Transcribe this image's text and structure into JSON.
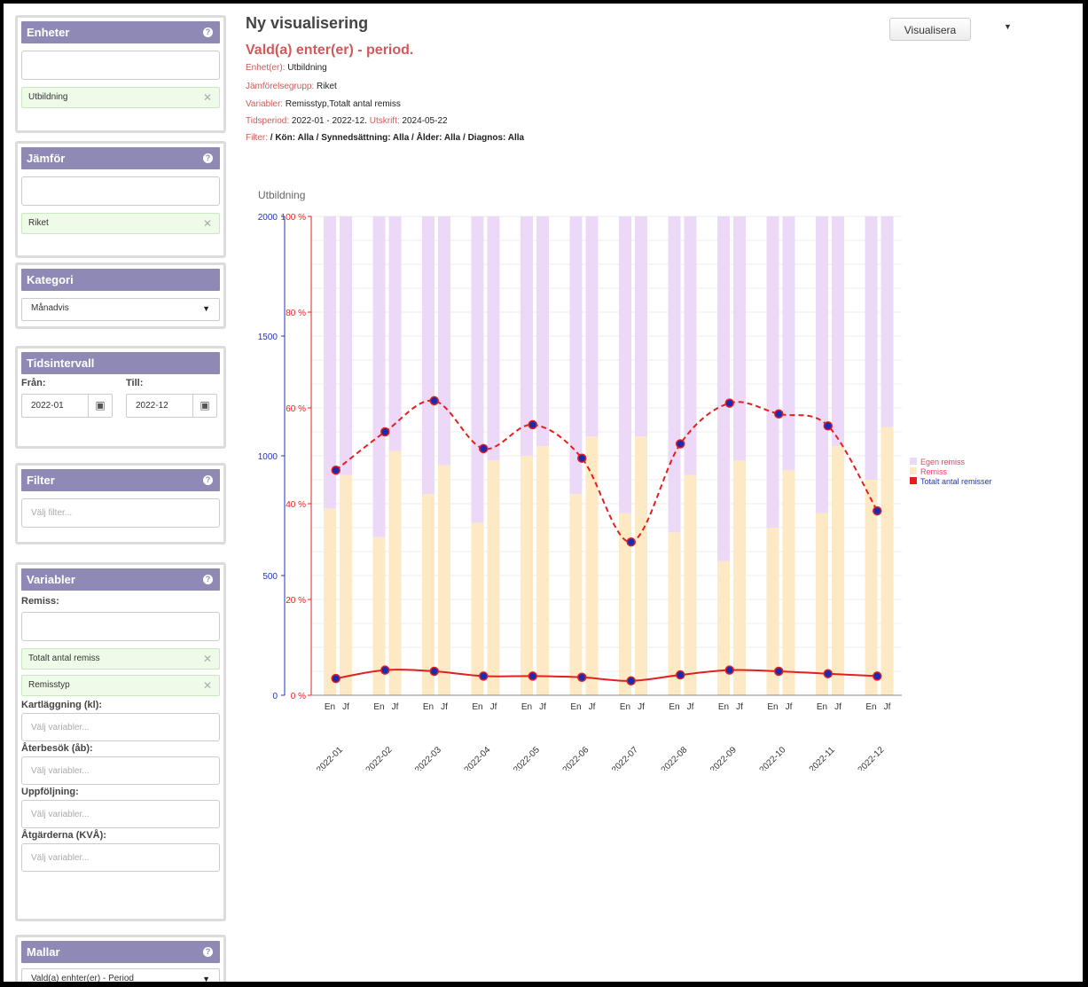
{
  "sidebar": {
    "enheter": {
      "title": "Enheter",
      "search_value": "",
      "tags": [
        "Utbildning"
      ]
    },
    "jamfor": {
      "title": "Jämför",
      "search_value": "",
      "tags": [
        "Riket"
      ]
    },
    "kategori": {
      "title": "Kategori",
      "selected": "Månadvis"
    },
    "tidsintervall": {
      "title": "Tidsintervall",
      "from_label": "Från:",
      "to_label": "Till:",
      "from_value": "2022-01",
      "to_value": "2022-12"
    },
    "filter": {
      "title": "Filter",
      "placeholder": "Välj filter..."
    },
    "variabler": {
      "title": "Variabler",
      "remiss_label": "Remiss:",
      "remiss_tags": [
        "Totalt antal remiss",
        "Remisstyp"
      ],
      "groups": [
        {
          "label": "Kartläggning (kl):",
          "placeholder": "Välj variabler..."
        },
        {
          "label": "Återbesök (åb):",
          "placeholder": "Välj variabler..."
        },
        {
          "label": "Uppföljning:",
          "placeholder": "Välj variabler..."
        },
        {
          "label": "Åtgärderna (KVÅ):",
          "placeholder": "Välj variabler..."
        }
      ]
    },
    "mallar": {
      "title": "Mallar",
      "selected": "Vald(a) enhter(er) - Period"
    }
  },
  "header": {
    "title": "Ny visualisering",
    "subtitle": "Vald(a) enter(er) - period.",
    "visualize_button": "Visualisera",
    "enheter_key": "Enhet(er):",
    "enheter_val": "Utbildning",
    "jamf_key": "Jämförelsegrupp:",
    "jamf_val": "Riket",
    "var_key": "Variabler:",
    "var_val": "Remisstyp,Totalt antal remiss",
    "tid_key": "Tidsperiod:",
    "tid_val": "2022-01 - 2022-12.",
    "utskrift_key": "Utskrift:",
    "utskrift_val": "2024-05-22",
    "filter_key": "Filter:",
    "filter_val": "/ Kön: Alla / Synnedsättning: Alla / Ålder: Alla / Diagnos: Alla"
  },
  "colors": {
    "egen": "#ecd9f7",
    "remiss": "#fde9c4",
    "line": "#e32020",
    "marker": "#1a2bb3",
    "left_axis": "#2233bb",
    "right_axis": "#e32020"
  },
  "chart_data": {
    "type": "bar",
    "title": "Utbildning",
    "categories": [
      "2022-01",
      "2022-02",
      "2022-03",
      "2022-04",
      "2022-05",
      "2022-06",
      "2022-07",
      "2022-08",
      "2022-09",
      "2022-10",
      "2022-11",
      "2022-12"
    ],
    "subcategories": [
      "En",
      "Jf"
    ],
    "left_axis": {
      "ylim": [
        0,
        2000
      ],
      "ticks": [
        "0",
        "500",
        "1000",
        "1500",
        "2000"
      ]
    },
    "right_axis": {
      "ylim": [
        0,
        100
      ],
      "ticks": [
        "0 %",
        "20 %",
        "40 %",
        "60 %",
        "80 %",
        "100 %"
      ]
    },
    "stacked_percent_series": [
      {
        "name": "Remiss",
        "en": [
          39,
          33,
          42,
          36,
          50,
          42,
          38,
          34,
          28,
          35,
          38,
          45
        ],
        "jf": [
          46,
          51,
          48,
          49,
          52,
          54,
          54,
          46,
          49,
          47,
          52,
          56
        ]
      },
      {
        "name": "Egen remiss",
        "en": [
          61,
          67,
          58,
          64,
          50,
          58,
          62,
          66,
          72,
          65,
          62,
          55
        ],
        "jf": [
          54,
          49,
          52,
          51,
          48,
          46,
          46,
          54,
          51,
          53,
          48,
          44
        ]
      }
    ],
    "line_series": [
      {
        "name": "Totalt antal remisser",
        "style": "dashed",
        "values": [
          940,
          1100,
          1230,
          1030,
          1130,
          990,
          640,
          1050,
          1220,
          1175,
          1125,
          770
        ]
      },
      {
        "name": "Totalt antal remisser",
        "style": "solid",
        "values": [
          70,
          105,
          100,
          80,
          80,
          75,
          60,
          85,
          105,
          100,
          90,
          80
        ]
      }
    ],
    "legend": {
      "position": "right",
      "entries": [
        "Egen remiss",
        "Remiss",
        "Totalt antal remisser"
      ]
    },
    "grid": true
  }
}
